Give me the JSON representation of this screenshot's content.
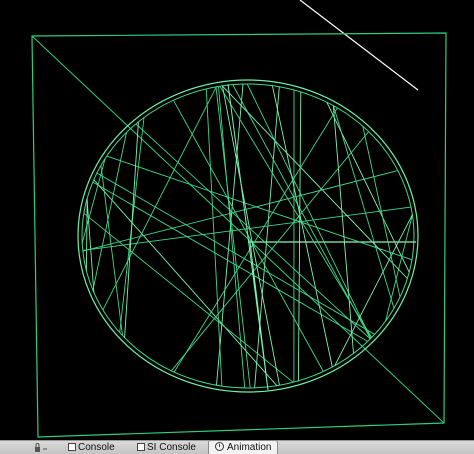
{
  "viewport": {
    "background": "#000000",
    "wire_color": "#3fd98a",
    "guide_color": "#ffffff",
    "spoke_count": 38
  },
  "bottom_tabs": [
    {
      "label": "Console",
      "icon": "console-box-icon"
    },
    {
      "label": "SI Console",
      "icon": "console-box-icon"
    },
    {
      "label": "Animation",
      "icon": "clock-icon",
      "active": true
    }
  ]
}
